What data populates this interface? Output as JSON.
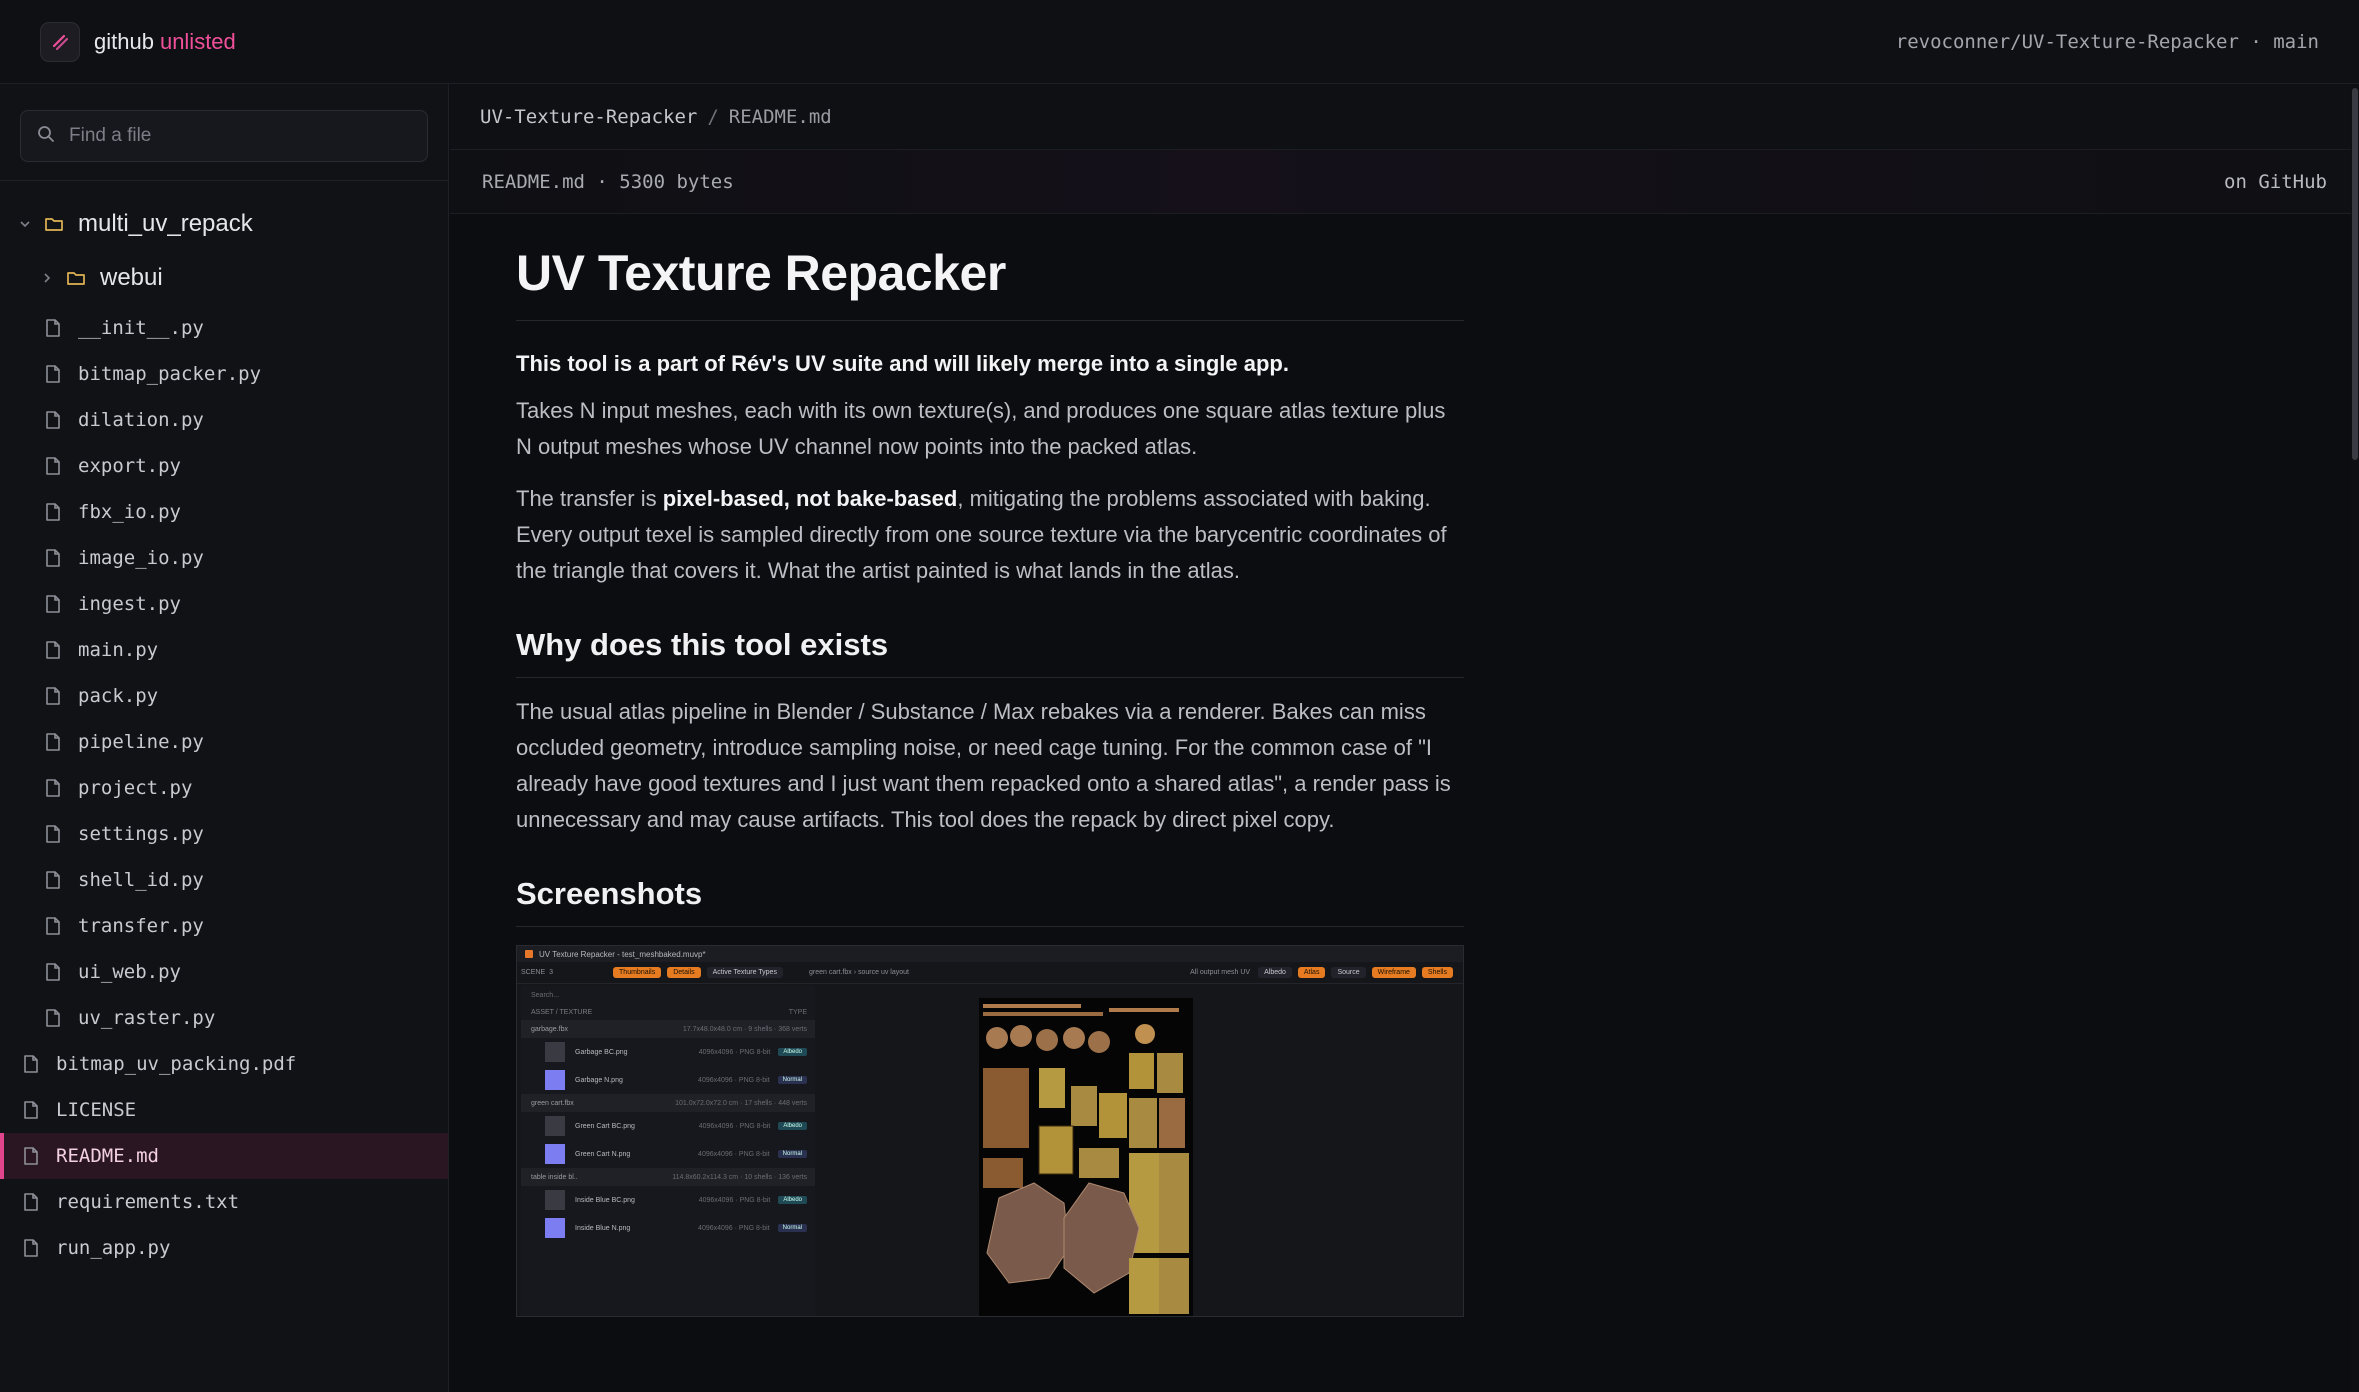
{
  "topbar": {
    "brand": "github",
    "brand_accent": "unlisted",
    "repo_ref": "revoconner/UV-Texture-Repacker · main"
  },
  "sidebar": {
    "search_placeholder": "Find a file",
    "root_folder": "multi_uv_repack",
    "sub_folder": "webui",
    "package_files": [
      "__init__.py",
      "bitmap_packer.py",
      "dilation.py",
      "export.py",
      "fbx_io.py",
      "image_io.py",
      "ingest.py",
      "main.py",
      "pack.py",
      "pipeline.py",
      "project.py",
      "settings.py",
      "shell_id.py",
      "transfer.py",
      "ui_web.py",
      "uv_raster.py"
    ],
    "root_files": [
      "bitmap_uv_packing.pdf",
      "LICENSE",
      "README.md",
      "requirements.txt",
      "run_app.py"
    ],
    "selected": "README.md"
  },
  "breadcrumb": {
    "repo": "UV-Texture-Repacker",
    "separator": "/",
    "file": "README.md"
  },
  "filebar": {
    "info": "README.md · 5300 bytes",
    "link": "on GitHub"
  },
  "readme": {
    "title": "UV Texture Repacker",
    "lead": "This tool is a part of Rév's UV suite and will likely merge into a single app.",
    "p1": "Takes N input meshes, each with its own texture(s), and produces one square atlas texture plus N output meshes whose UV channel now points into the packed atlas.",
    "p2_pre": "The transfer is ",
    "p2_bold": "pixel-based, not bake-based",
    "p2_post": ", mitigating the problems associated with baking. Every output texel is sampled directly from one source texture via the barycentric coordinates of the triangle that covers it. What the artist painted is what lands in the atlas.",
    "h2_why": "Why does this tool exists",
    "p3": "The usual atlas pipeline in Blender / Substance / Max rebakes via a renderer. Bakes can miss occluded geometry, introduce sampling noise, or need cage tuning. For the common case of \"I already have good textures and I just want them repacked onto a shared atlas\", a render pass is unnecessary and may cause artifacts. This tool does the repack by direct pixel copy.",
    "h2_shots": "Screenshots"
  },
  "screenshot": {
    "window_title": "UV Texture Repacker - test_meshbaked.muvp*",
    "scene_label": "SCENE",
    "scene_count": "3",
    "tabs": [
      "Thumbnails",
      "Details",
      "Active Texture Types"
    ],
    "search": "Search...",
    "columns": [
      "ASSET / TEXTURE",
      "TYPE"
    ],
    "breadcrumb": "green cart.fbx › source uv layout",
    "view_select": "All output mesh UV",
    "channel_select": "Albedo",
    "view_tabs": [
      "Atlas",
      "Source"
    ],
    "view_buttons": [
      "Wireframe",
      "Shells"
    ],
    "groups": [
      {
        "name": "garbage.fbx",
        "meta": "17.7x48.0x48.0 cm · 9 shells · 368 verts",
        "files": [
          {
            "name": "Garbage BC.png",
            "meta": "4096x4096 · PNG 8-bit",
            "type": "Albedo"
          },
          {
            "name": "Garbage N.png",
            "meta": "4096x4096 · PNG 8-bit",
            "type": "Normal"
          }
        ]
      },
      {
        "name": "green cart.fbx",
        "meta": "101.0x72.0x72.0 cm · 17 shells · 448 verts",
        "files": [
          {
            "name": "Green Cart BC.png",
            "meta": "4096x4096 · PNG 8-bit",
            "type": "Albedo"
          },
          {
            "name": "Green Cart N.png",
            "meta": "4096x4096 · PNG 8-bit",
            "type": "Normal"
          }
        ]
      },
      {
        "name": "table inside bl..",
        "meta": "114.8x60.2x114.3 cm · 10 shells · 136 verts",
        "files": [
          {
            "name": "Inside Blue BC.png",
            "meta": "4096x4096 · PNG 8-bit",
            "type": "Albedo"
          },
          {
            "name": "Inside Blue N.png",
            "meta": "4096x4096 · PNG 8-bit",
            "type": "Normal"
          }
        ]
      }
    ]
  },
  "colors": {
    "accent": "#f0509a",
    "selected_bg": "#2a1622",
    "folder_icon": "#e0b455"
  }
}
